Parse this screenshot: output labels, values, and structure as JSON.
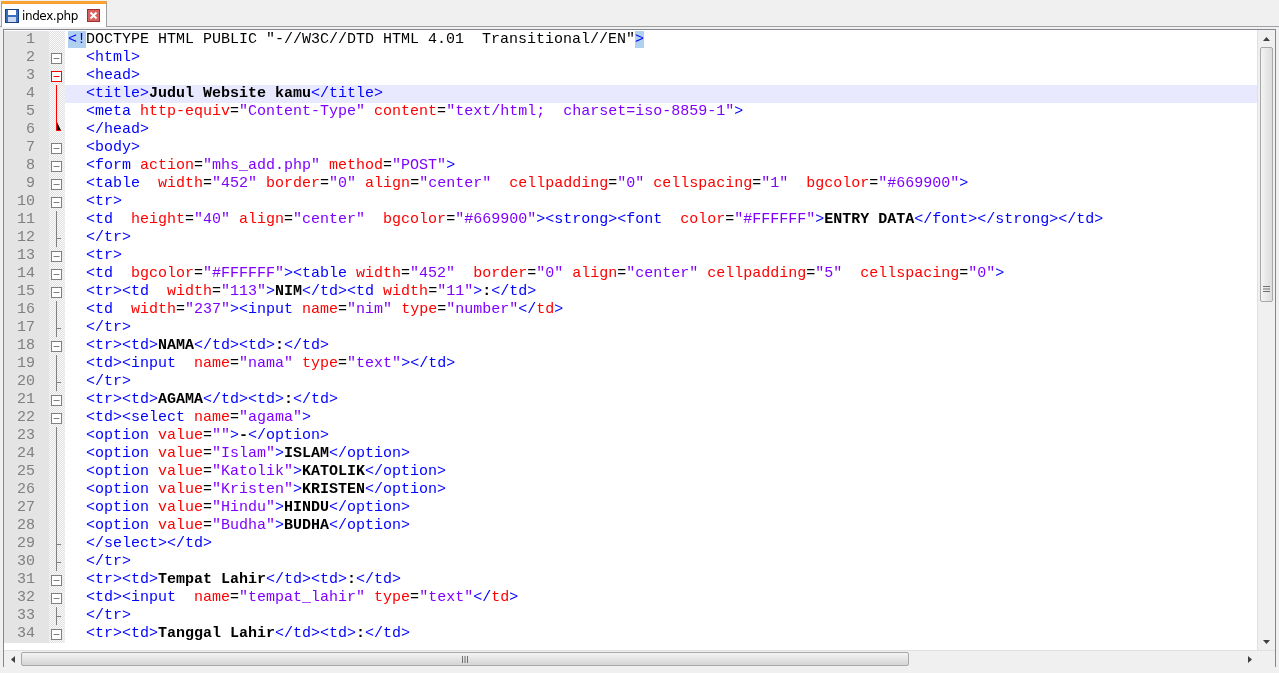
{
  "tabs": [
    {
      "title": "index.php",
      "selected": true
    }
  ],
  "lines": [
    {
      "number": "1",
      "kind": "none",
      "selected": false,
      "tokens": [
        {
          "kind": "match",
          "text": "<!"
        },
        {
          "kind": "sgml",
          "text": "DOCTYPE HTML PUBLIC \"-//W3C//DTD HTML 4.01  Transitional//EN\""
        },
        {
          "kind": "match",
          "text": ">"
        }
      ]
    },
    {
      "number": "2",
      "kind": "box",
      "selected": false,
      "tokens": [
        {
          "kind": "tag",
          "text": "  <html>"
        }
      ]
    },
    {
      "number": "3",
      "kind": "box-active",
      "selected": false,
      "tokens": [
        {
          "kind": "tag",
          "text": "  <head>"
        }
      ]
    },
    {
      "number": "4",
      "kind": "line-active",
      "selected": true,
      "tokens": [
        {
          "kind": "tag",
          "text": "  <title>"
        },
        {
          "kind": "text",
          "text": "Judul Website kamu"
        },
        {
          "kind": "tag",
          "text": "</title>"
        }
      ]
    },
    {
      "number": "5",
      "kind": "line-active",
      "selected": false,
      "tokens": [
        {
          "kind": "tag",
          "text": "  <meta"
        },
        {
          "kind": "attr",
          "text": " http-equiv"
        },
        {
          "kind": "op",
          "text": "="
        },
        {
          "kind": "value",
          "text": "\"Content-Type\""
        },
        {
          "kind": "attr",
          "text": " content"
        },
        {
          "kind": "op",
          "text": "="
        },
        {
          "kind": "value",
          "text": "\"text/html;  charset=iso-8859-1\""
        },
        {
          "kind": "tag",
          "text": ">"
        }
      ]
    },
    {
      "number": "6",
      "kind": "end-active",
      "selected": false,
      "tokens": [
        {
          "kind": "tag",
          "text": "  </head>"
        }
      ]
    },
    {
      "number": "7",
      "kind": "box",
      "selected": false,
      "tokens": [
        {
          "kind": "tag",
          "text": "  <body>"
        }
      ]
    },
    {
      "number": "8",
      "kind": "box",
      "selected": false,
      "tokens": [
        {
          "kind": "tag",
          "text": "  <form"
        },
        {
          "kind": "attr",
          "text": " action"
        },
        {
          "kind": "op",
          "text": "="
        },
        {
          "kind": "value",
          "text": "\"mhs_add.php\""
        },
        {
          "kind": "attr",
          "text": " method"
        },
        {
          "kind": "op",
          "text": "="
        },
        {
          "kind": "value",
          "text": "\"POST\""
        },
        {
          "kind": "tag",
          "text": ">"
        }
      ]
    },
    {
      "number": "9",
      "kind": "box",
      "selected": false,
      "tokens": [
        {
          "kind": "tag",
          "text": "  <table"
        },
        {
          "kind": "attr",
          "text": "  width"
        },
        {
          "kind": "op",
          "text": "="
        },
        {
          "kind": "value",
          "text": "\"452\""
        },
        {
          "kind": "attr",
          "text": " border"
        },
        {
          "kind": "op",
          "text": "="
        },
        {
          "kind": "value",
          "text": "\"0\""
        },
        {
          "kind": "attr",
          "text": " align"
        },
        {
          "kind": "op",
          "text": "="
        },
        {
          "kind": "value",
          "text": "\"center\""
        },
        {
          "kind": "attr",
          "text": "  cellpadding"
        },
        {
          "kind": "op",
          "text": "="
        },
        {
          "kind": "value",
          "text": "\"0\""
        },
        {
          "kind": "attr",
          "text": " cellspacing"
        },
        {
          "kind": "op",
          "text": "="
        },
        {
          "kind": "value",
          "text": "\"1\""
        },
        {
          "kind": "attr",
          "text": "  bgcolor"
        },
        {
          "kind": "op",
          "text": "="
        },
        {
          "kind": "value",
          "text": "\"#669900\""
        },
        {
          "kind": "tag",
          "text": ">"
        }
      ]
    },
    {
      "number": "10",
      "kind": "box",
      "selected": false,
      "tokens": [
        {
          "kind": "tag",
          "text": "  <tr>"
        }
      ]
    },
    {
      "number": "11",
      "kind": "line",
      "selected": false,
      "tokens": [
        {
          "kind": "tag",
          "text": "  <td"
        },
        {
          "kind": "attr",
          "text": "  height"
        },
        {
          "kind": "op",
          "text": "="
        },
        {
          "kind": "value",
          "text": "\"40\""
        },
        {
          "kind": "attr",
          "text": " align"
        },
        {
          "kind": "op",
          "text": "="
        },
        {
          "kind": "value",
          "text": "\"center\""
        },
        {
          "kind": "attr",
          "text": "  bgcolor"
        },
        {
          "kind": "op",
          "text": "="
        },
        {
          "kind": "value",
          "text": "\"#669900\""
        },
        {
          "kind": "tag",
          "text": "><strong><font"
        },
        {
          "kind": "attr",
          "text": "  color"
        },
        {
          "kind": "op",
          "text": "="
        },
        {
          "kind": "value",
          "text": "\"#FFFFFF\""
        },
        {
          "kind": "tag",
          "text": ">"
        },
        {
          "kind": "text",
          "text": "ENTRY DATA"
        },
        {
          "kind": "tag",
          "text": "</font></strong></td>"
        }
      ]
    },
    {
      "number": "12",
      "kind": "end",
      "selected": false,
      "tokens": [
        {
          "kind": "tag",
          "text": "  </tr>"
        }
      ]
    },
    {
      "number": "13",
      "kind": "box",
      "selected": false,
      "tokens": [
        {
          "kind": "tag",
          "text": "  <tr>"
        }
      ]
    },
    {
      "number": "14",
      "kind": "box",
      "selected": false,
      "tokens": [
        {
          "kind": "tag",
          "text": "  <td"
        },
        {
          "kind": "attr",
          "text": "  bgcolor"
        },
        {
          "kind": "op",
          "text": "="
        },
        {
          "kind": "value",
          "text": "\"#FFFFFF\""
        },
        {
          "kind": "tag",
          "text": "><table"
        },
        {
          "kind": "attr",
          "text": " width"
        },
        {
          "kind": "op",
          "text": "="
        },
        {
          "kind": "value",
          "text": "\"452\""
        },
        {
          "kind": "attr",
          "text": "  border"
        },
        {
          "kind": "op",
          "text": "="
        },
        {
          "kind": "value",
          "text": "\"0\""
        },
        {
          "kind": "attr",
          "text": " align"
        },
        {
          "kind": "op",
          "text": "="
        },
        {
          "kind": "value",
          "text": "\"center\""
        },
        {
          "kind": "attr",
          "text": " cellpadding"
        },
        {
          "kind": "op",
          "text": "="
        },
        {
          "kind": "value",
          "text": "\"5\""
        },
        {
          "kind": "attr",
          "text": "  cellspacing"
        },
        {
          "kind": "op",
          "text": "="
        },
        {
          "kind": "value",
          "text": "\"0\""
        },
        {
          "kind": "tag",
          "text": ">"
        }
      ]
    },
    {
      "number": "15",
      "kind": "box",
      "selected": false,
      "tokens": [
        {
          "kind": "tag",
          "text": "  <tr><td"
        },
        {
          "kind": "attr",
          "text": "  width"
        },
        {
          "kind": "op",
          "text": "="
        },
        {
          "kind": "value",
          "text": "\"113\""
        },
        {
          "kind": "tag",
          "text": ">"
        },
        {
          "kind": "text",
          "text": "NIM"
        },
        {
          "kind": "tag",
          "text": "</td><td"
        },
        {
          "kind": "attr",
          "text": " width"
        },
        {
          "kind": "op",
          "text": "="
        },
        {
          "kind": "value",
          "text": "\"11\""
        },
        {
          "kind": "tag",
          "text": ">"
        },
        {
          "kind": "text",
          "text": ":"
        },
        {
          "kind": "tag",
          "text": "</td>"
        }
      ]
    },
    {
      "number": "16",
      "kind": "line",
      "selected": false,
      "tokens": [
        {
          "kind": "tag",
          "text": "  <td"
        },
        {
          "kind": "attr",
          "text": "  width"
        },
        {
          "kind": "op",
          "text": "="
        },
        {
          "kind": "value",
          "text": "\"237\""
        },
        {
          "kind": "tag",
          "text": "><input"
        },
        {
          "kind": "attr",
          "text": " name"
        },
        {
          "kind": "op",
          "text": "="
        },
        {
          "kind": "value",
          "text": "\"nim\""
        },
        {
          "kind": "attr",
          "text": " type"
        },
        {
          "kind": "op",
          "text": "="
        },
        {
          "kind": "value",
          "text": "\"number\""
        },
        {
          "kind": "tag",
          "text": "</"
        },
        {
          "kind": "attr",
          "text": "td"
        },
        {
          "kind": "tag",
          "text": ">"
        }
      ]
    },
    {
      "number": "17",
      "kind": "end",
      "selected": false,
      "tokens": [
        {
          "kind": "tag",
          "text": "  </tr>"
        }
      ]
    },
    {
      "number": "18",
      "kind": "box",
      "selected": false,
      "tokens": [
        {
          "kind": "tag",
          "text": "  <tr><td>"
        },
        {
          "kind": "text",
          "text": "NAMA"
        },
        {
          "kind": "tag",
          "text": "</td><td>"
        },
        {
          "kind": "text",
          "text": ":"
        },
        {
          "kind": "tag",
          "text": "</td>"
        }
      ]
    },
    {
      "number": "19",
      "kind": "line",
      "selected": false,
      "tokens": [
        {
          "kind": "tag",
          "text": "  <td><input"
        },
        {
          "kind": "attr",
          "text": "  name"
        },
        {
          "kind": "op",
          "text": "="
        },
        {
          "kind": "value",
          "text": "\"nama\""
        },
        {
          "kind": "attr",
          "text": " type"
        },
        {
          "kind": "op",
          "text": "="
        },
        {
          "kind": "value",
          "text": "\"text\""
        },
        {
          "kind": "tag",
          "text": "></td>"
        }
      ]
    },
    {
      "number": "20",
      "kind": "end",
      "selected": false,
      "tokens": [
        {
          "kind": "tag",
          "text": "  </tr>"
        }
      ]
    },
    {
      "number": "21",
      "kind": "box",
      "selected": false,
      "tokens": [
        {
          "kind": "tag",
          "text": "  <tr><td>"
        },
        {
          "kind": "text",
          "text": "AGAMA"
        },
        {
          "kind": "tag",
          "text": "</td><td>"
        },
        {
          "kind": "text",
          "text": ":"
        },
        {
          "kind": "tag",
          "text": "</td>"
        }
      ]
    },
    {
      "number": "22",
      "kind": "box",
      "selected": false,
      "tokens": [
        {
          "kind": "tag",
          "text": "  <td><select"
        },
        {
          "kind": "attr",
          "text": " name"
        },
        {
          "kind": "op",
          "text": "="
        },
        {
          "kind": "value",
          "text": "\"agama\""
        },
        {
          "kind": "tag",
          "text": ">"
        }
      ]
    },
    {
      "number": "23",
      "kind": "line",
      "selected": false,
      "tokens": [
        {
          "kind": "tag",
          "text": "  <option"
        },
        {
          "kind": "attr",
          "text": " value"
        },
        {
          "kind": "op",
          "text": "="
        },
        {
          "kind": "value",
          "text": "\"\""
        },
        {
          "kind": "tag",
          "text": ">"
        },
        {
          "kind": "text",
          "text": "-"
        },
        {
          "kind": "tag",
          "text": "</option>"
        }
      ]
    },
    {
      "number": "24",
      "kind": "line",
      "selected": false,
      "tokens": [
        {
          "kind": "tag",
          "text": "  <option"
        },
        {
          "kind": "attr",
          "text": " value"
        },
        {
          "kind": "op",
          "text": "="
        },
        {
          "kind": "value",
          "text": "\"Islam\""
        },
        {
          "kind": "tag",
          "text": ">"
        },
        {
          "kind": "text",
          "text": "ISLAM"
        },
        {
          "kind": "tag",
          "text": "</option>"
        }
      ]
    },
    {
      "number": "25",
      "kind": "line",
      "selected": false,
      "tokens": [
        {
          "kind": "tag",
          "text": "  <option"
        },
        {
          "kind": "attr",
          "text": " value"
        },
        {
          "kind": "op",
          "text": "="
        },
        {
          "kind": "value",
          "text": "\"Katolik\""
        },
        {
          "kind": "tag",
          "text": ">"
        },
        {
          "kind": "text",
          "text": "KATOLIK"
        },
        {
          "kind": "tag",
          "text": "</option>"
        }
      ]
    },
    {
      "number": "26",
      "kind": "line",
      "selected": false,
      "tokens": [
        {
          "kind": "tag",
          "text": "  <option"
        },
        {
          "kind": "attr",
          "text": " value"
        },
        {
          "kind": "op",
          "text": "="
        },
        {
          "kind": "value",
          "text": "\"Kristen\""
        },
        {
          "kind": "tag",
          "text": ">"
        },
        {
          "kind": "text",
          "text": "KRISTEN"
        },
        {
          "kind": "tag",
          "text": "</option>"
        }
      ]
    },
    {
      "number": "27",
      "kind": "line",
      "selected": false,
      "tokens": [
        {
          "kind": "tag",
          "text": "  <option"
        },
        {
          "kind": "attr",
          "text": " value"
        },
        {
          "kind": "op",
          "text": "="
        },
        {
          "kind": "value",
          "text": "\"Hindu\""
        },
        {
          "kind": "tag",
          "text": ">"
        },
        {
          "kind": "text",
          "text": "HINDU"
        },
        {
          "kind": "tag",
          "text": "</option>"
        }
      ]
    },
    {
      "number": "28",
      "kind": "line",
      "selected": false,
      "tokens": [
        {
          "kind": "tag",
          "text": "  <option"
        },
        {
          "kind": "attr",
          "text": " value"
        },
        {
          "kind": "op",
          "text": "="
        },
        {
          "kind": "value",
          "text": "\"Budha\""
        },
        {
          "kind": "tag",
          "text": ">"
        },
        {
          "kind": "text",
          "text": "BUDHA"
        },
        {
          "kind": "tag",
          "text": "</option>"
        }
      ]
    },
    {
      "number": "29",
      "kind": "end",
      "selected": false,
      "tokens": [
        {
          "kind": "tag",
          "text": "  </select></td>"
        }
      ]
    },
    {
      "number": "30",
      "kind": "end",
      "selected": false,
      "tokens": [
        {
          "kind": "tag",
          "text": "  </tr>"
        }
      ]
    },
    {
      "number": "31",
      "kind": "box",
      "selected": false,
      "tokens": [
        {
          "kind": "tag",
          "text": "  <tr><td>"
        },
        {
          "kind": "text",
          "text": "Tempat Lahir"
        },
        {
          "kind": "tag",
          "text": "</td><td>"
        },
        {
          "kind": "text",
          "text": ":"
        },
        {
          "kind": "tag",
          "text": "</td>"
        }
      ]
    },
    {
      "number": "32",
      "kind": "box",
      "selected": false,
      "tokens": [
        {
          "kind": "tag",
          "text": "  <td><input"
        },
        {
          "kind": "attr",
          "text": "  name"
        },
        {
          "kind": "op",
          "text": "="
        },
        {
          "kind": "value",
          "text": "\"tempat_lahir\""
        },
        {
          "kind": "attr",
          "text": " type"
        },
        {
          "kind": "op",
          "text": "="
        },
        {
          "kind": "value",
          "text": "\"text\""
        },
        {
          "kind": "tag",
          "text": "</"
        },
        {
          "kind": "attr",
          "text": "td"
        },
        {
          "kind": "tag",
          "text": ">"
        }
      ]
    },
    {
      "number": "33",
      "kind": "end",
      "selected": false,
      "tokens": [
        {
          "kind": "tag",
          "text": "  </tr>"
        }
      ]
    },
    {
      "number": "34",
      "kind": "box",
      "selected": false,
      "tokens": [
        {
          "kind": "tag",
          "text": "  <tr><td>"
        },
        {
          "kind": "text",
          "text": "Tanggal Lahir"
        },
        {
          "kind": "tag",
          "text": "</td><td>"
        },
        {
          "kind": "text",
          "text": ":"
        },
        {
          "kind": "tag",
          "text": "</td>"
        }
      ]
    }
  ]
}
